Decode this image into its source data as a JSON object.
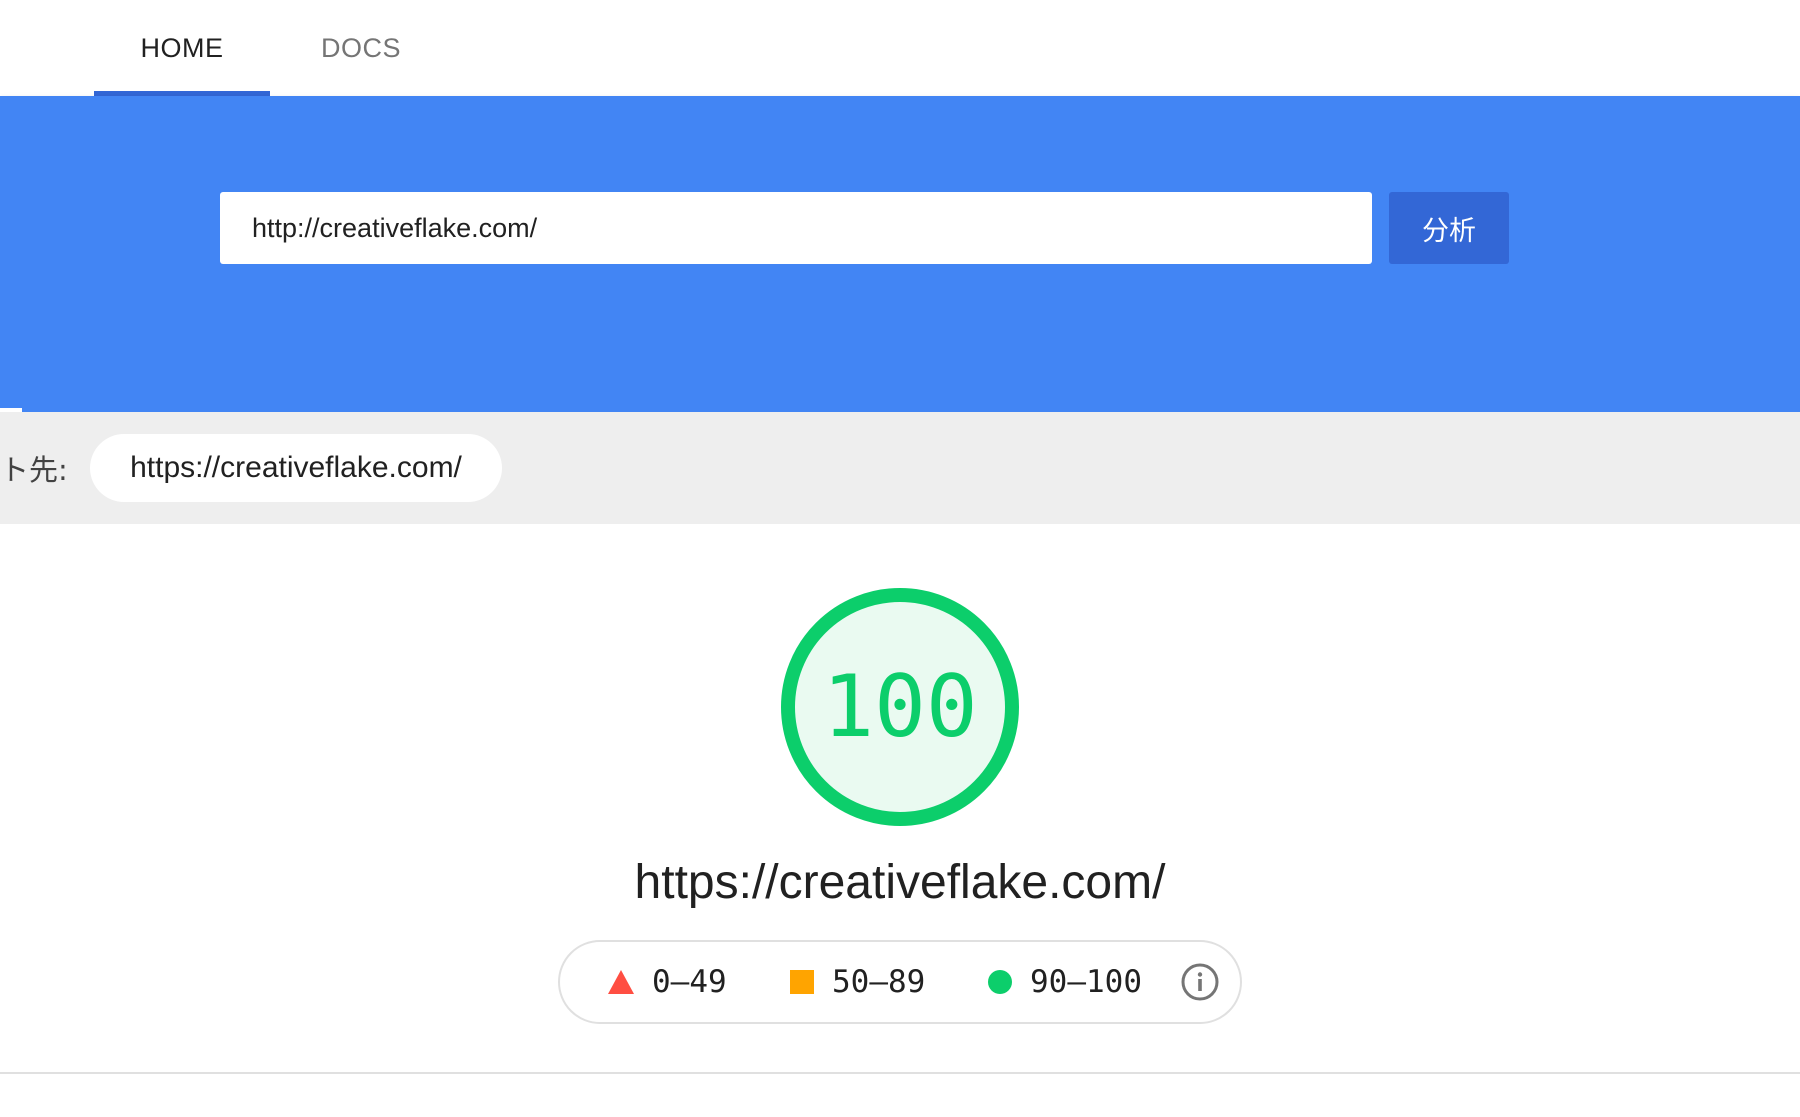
{
  "nav": {
    "tabs": [
      {
        "label": "HOME",
        "active": true
      },
      {
        "label": "DOCS",
        "active": false
      }
    ]
  },
  "search": {
    "url_value": "http://creativeflake.com/",
    "analyze_label": "分析"
  },
  "redirect": {
    "label": "ト先:",
    "url": "https://creativeflake.com/"
  },
  "score": {
    "value": "100",
    "fraction": 1.0,
    "color": "#0cce6b"
  },
  "result": {
    "final_url": "https://creativeflake.com/"
  },
  "legend": {
    "fail_range": "0–49",
    "average_range": "50–89",
    "pass_range": "90–100",
    "fail_color": "#ff4e42",
    "average_color": "#ffa400",
    "pass_color": "#0cce6b"
  },
  "colors": {
    "hero_blue": "#4285f4",
    "button_blue": "#3367d6"
  }
}
